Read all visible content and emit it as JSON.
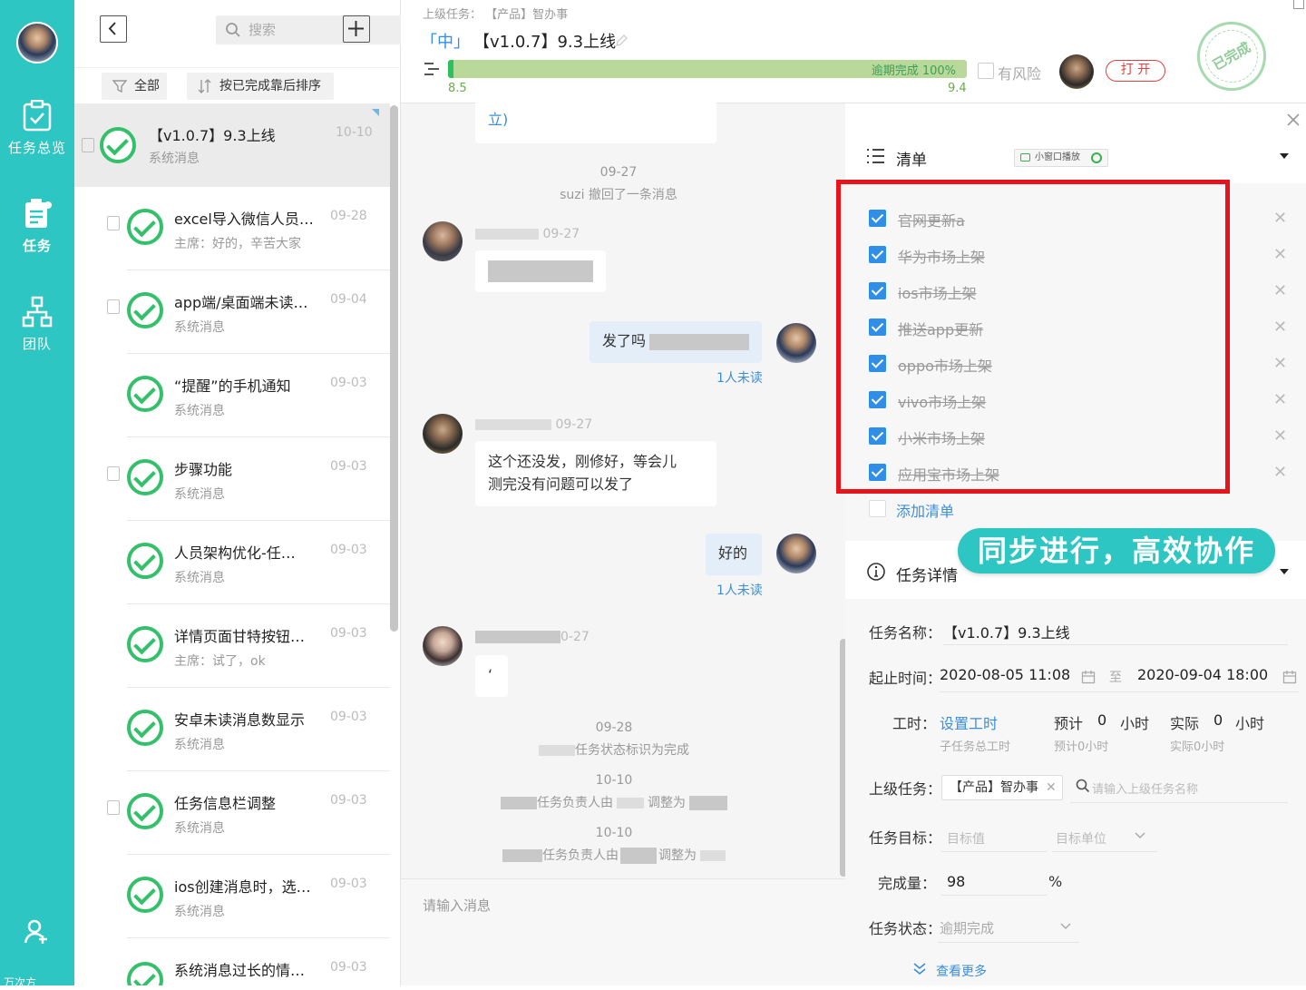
{
  "sidebar": {
    "items": [
      {
        "label": "任务总览",
        "icon": "task-overview-icon"
      },
      {
        "label": "任务",
        "icon": "task-icon"
      },
      {
        "label": "团队",
        "icon": "team-icon"
      }
    ],
    "bottom_label": "万次方"
  },
  "list": {
    "search_placeholder": "搜索",
    "filter_label": "全部",
    "sort_label": "按已完成靠后排序",
    "items": [
      {
        "title": "【v1.0.7】9.3上线",
        "sub": "系统消息",
        "date": "10-10"
      },
      {
        "title": "excel导入微信人员…",
        "sub": "主席：好的，辛苦大家",
        "date": "09-28"
      },
      {
        "title": "app端/桌面端未读…",
        "sub": "系统消息",
        "date": "09-04"
      },
      {
        "title": "“提醒”的手机通知",
        "sub": "系统消息",
        "date": "09-03"
      },
      {
        "title": "步骤功能",
        "sub": "系统消息",
        "date": "09-03"
      },
      {
        "title": "人员架构优化-任…",
        "sub": "系统消息",
        "date": "09-03"
      },
      {
        "title": "详情页面甘特按钮…",
        "sub": "主席：试了，ok",
        "date": "09-03"
      },
      {
        "title": "安卓未读消息数显示",
        "sub": "系统消息",
        "date": "09-03"
      },
      {
        "title": "任务信息栏调整",
        "sub": "系统消息",
        "date": "09-03"
      },
      {
        "title": "ios创建消息时，选…",
        "sub": "系统消息",
        "date": "09-03"
      },
      {
        "title": "系统消息过长的情…",
        "sub": "",
        "date": "09-03"
      }
    ]
  },
  "header": {
    "parent_label": "上级任务：",
    "parent_value": "【产品】智办事",
    "priority": "「中」",
    "title": "【v1.0.7】9.3上线",
    "progress_text": "逾期完成 100%",
    "progress": 1.0,
    "start_mark": "8.5",
    "end_mark": "9.4",
    "risk_label": "有风险",
    "open_button": "打 开",
    "stamp_text": "已完成"
  },
  "chat": {
    "top_bubble": "立)",
    "recall_date": "09-27",
    "recall_text": "suzi 撤回了一条消息",
    "msg1_meta": "09-27",
    "msg2_text": "发了吗",
    "msg2_unread": "1人未读",
    "msg3_meta": "09-27",
    "msg3_text_line1": "这个还没发，刚修好，等会儿",
    "msg3_text_line2": "测完没有问题可以发了",
    "msg4_text": "好的",
    "msg4_unread": "1人未读",
    "msg5_meta": "0-27",
    "msg5_text": "‘",
    "sys1_date": "09-28",
    "sys1_text": "任务状态标识为完成",
    "sys2_date": "10-10",
    "sys2_text": "任务负责人由",
    "sys2_mid": "调整为",
    "sys3_date": "10-10",
    "sys3_text": "任务负责人由",
    "sys3_mid": "调整为",
    "input_placeholder": "请输入消息"
  },
  "checklist": {
    "title": "清单",
    "badge": "小窗口播放",
    "items": [
      "官网更新a",
      "华为市场上架",
      "ios市场上架",
      "推送app更新",
      "oppo市场上架",
      "vivo市场上架",
      "小米市场上架",
      "应用宝市场上架"
    ],
    "add_label": "添加清单"
  },
  "banner": "同步进行，高效协作",
  "details": {
    "section_title": "任务详情",
    "name_label": "任务名称：",
    "name_value": "【v1.0.7】9.3上线",
    "time_label": "起止时间：",
    "start": "2020-08-05 11:08",
    "to": "至",
    "end": "2020-09-04 18:00",
    "hours_label": "工时：",
    "set_hours": "设置工时",
    "sub_hours": "子任务总工时",
    "est_label": "预计",
    "est_value": "0",
    "est_unit": "小时",
    "est_sub": "预计0小时",
    "act_label": "实际",
    "act_value": "0",
    "act_unit": "小时",
    "act_sub": "实际0小时",
    "parent_label": "上级任务：",
    "parent_tag": "【产品】智办事",
    "parent_placeholder": "请输入上级任务名称",
    "goal_label": "任务目标：",
    "goal_placeholder": "目标值",
    "goal_unit_placeholder": "目标单位",
    "done_label": "完成量：",
    "done_value": "98",
    "done_unit": "%",
    "status_label": "任务状态：",
    "status_value": "逾期完成",
    "more_label": "查看更多"
  }
}
